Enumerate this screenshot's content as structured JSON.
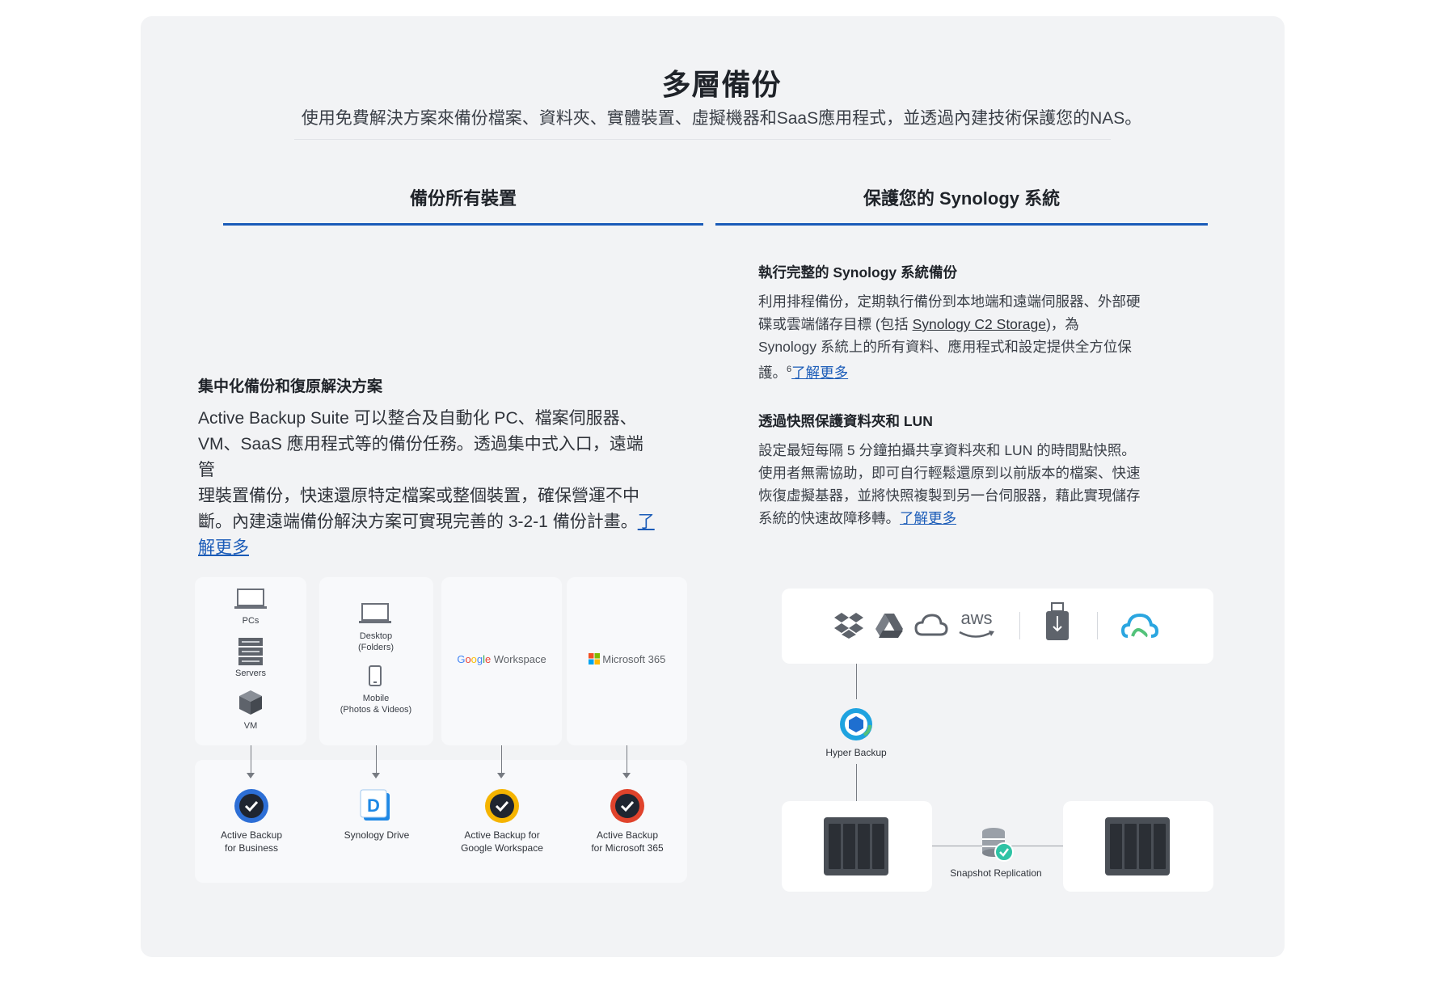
{
  "header": {
    "title": "多層備份",
    "subtitle": "使用免費解決方案來備份檔案、資料夾、實體裝置、虛擬機器和SaaS應用程式，並透過內建技術保護您的NAS。"
  },
  "tabs": [
    {
      "label": "備份所有裝置"
    },
    {
      "label": "保護您的 Synology 系統"
    }
  ],
  "left": {
    "heading": "集中化備份和復原解決方案",
    "line1": "Active Backup Suite 可以整合及自動化 PC、檔案伺服器、",
    "line2": "VM、SaaS 應用程式等的備份任務。透過集中式入口，遠端管",
    "line3": "理裝置備份，快速還原特定檔案或整個裝置，確保營運不中",
    "line4": "斷。內建遠端備份解決方案可實現完善的 3-2-1 備份計畫。",
    "link_a": "了",
    "link_b": "解更多"
  },
  "right": {
    "section1": {
      "heading": "執行完整的 Synology 系統備份",
      "line1": "利用排程備份，定期執行備份到本地端和遠端伺服器、外部硬",
      "line2_a": "碟或雲端儲存目標 (包括 ",
      "line2_link": "Synology C2 Storage",
      "line2_b": ")，為",
      "line3": "Synology 系統上的所有資料、應用程式和設定提供全方位保",
      "line4": "護。",
      "footnote": "6",
      "link": "了解更多"
    },
    "section2": {
      "heading": "透過快照保護資料夾和 LUN",
      "line1": "設定最短每隔 5 分鐘拍攝共享資料夾和 LUN 的時間點快照。",
      "line2": "使用者無需協助，即可自行輕鬆還原到以前版本的檔案、快速",
      "line3": "恢復虛擬基器，並將快照複製到另一台伺服器，藉此實現儲存",
      "line4": "系統的快速故障移轉。",
      "link": "了解更多"
    }
  },
  "diagram_left": {
    "pcs": "PCs",
    "servers": "Servers",
    "vm": "VM",
    "desktop_1": "Desktop",
    "desktop_2": "(Folders)",
    "mobile_1": "Mobile",
    "mobile_2": "(Photos & Videos)",
    "google_workspace": "Workspace",
    "google_letters": [
      "G",
      "o",
      "o",
      "g",
      "l",
      "e"
    ],
    "microsoft365": "Microsoft 365",
    "products": [
      {
        "l1": "Active Backup",
        "l2": "for Business"
      },
      {
        "l1": "Synology Drive",
        "l2": ""
      },
      {
        "l1": "Active Backup for",
        "l2": "Google Workspace"
      },
      {
        "l1": "Active Backup",
        "l2": "for Microsoft 365"
      }
    ]
  },
  "diagram_right": {
    "aws": "aws",
    "hyper_backup": "Hyper Backup",
    "snapshot_replication": "Snapshot Replication"
  },
  "colors": {
    "accent": "#1a5bb8",
    "panel": "#f2f3f5",
    "card": "#f8f9fb",
    "google_blue": "#4285F4",
    "google_red": "#EA4335",
    "google_yellow": "#FBBC05",
    "google_green": "#34A853"
  }
}
